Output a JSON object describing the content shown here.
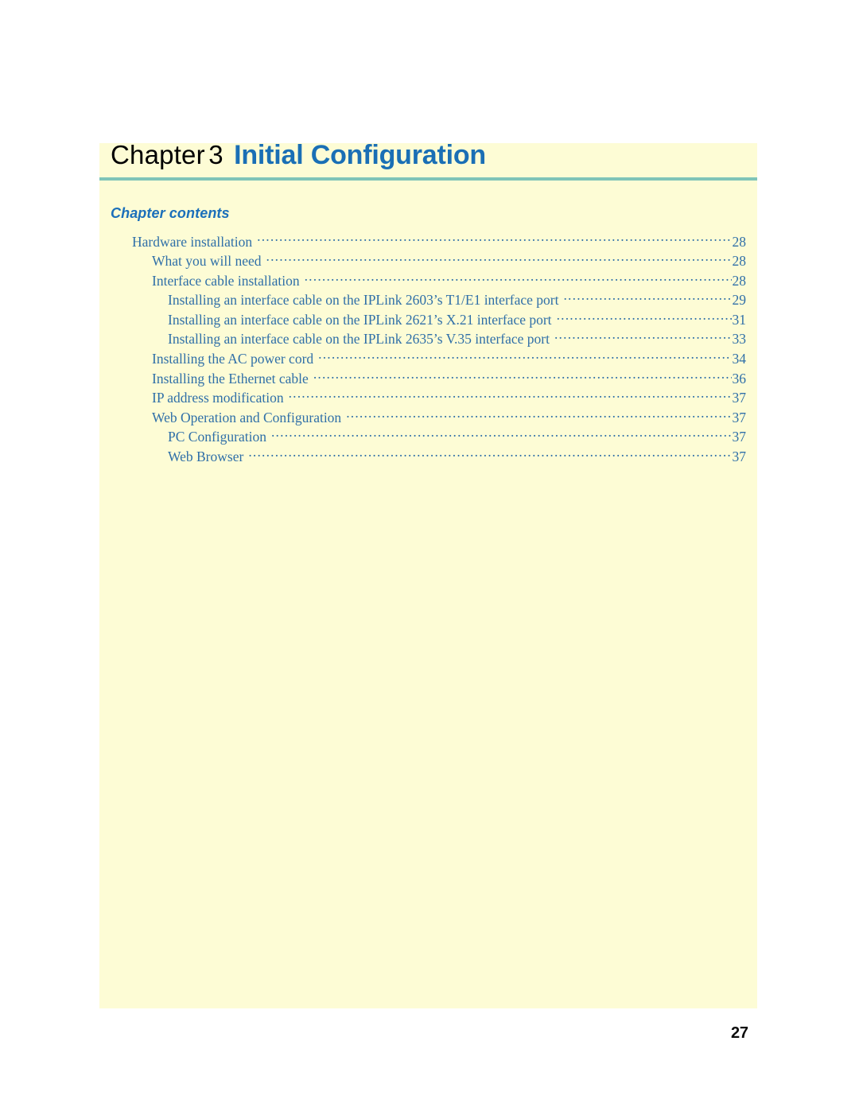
{
  "colors": {
    "panel_background": "#fdfcd5",
    "title_blue": "#1a6fb5",
    "heading_blue": "#1b6fba",
    "toc_blue": "#2f6fa8",
    "rule_teal": "#7fc4b8",
    "folio_black": "#0d0d0d"
  },
  "header": {
    "chapter_word": "Chapter",
    "chapter_number": "3",
    "chapter_name": "Initial Configuration"
  },
  "contents": {
    "heading": "Chapter contents",
    "entries": [
      {
        "label": "Hardware installation",
        "page": "28",
        "level": 1
      },
      {
        "label": "What you will need",
        "page": "28",
        "level": 2
      },
      {
        "label": "Interface cable installation",
        "page": "28",
        "level": 2
      },
      {
        "label": "Installing an interface cable on the IPLink 2603’s T1/E1 interface port",
        "page": "29",
        "level": 3
      },
      {
        "label": "Installing an interface cable on the IPLink 2621’s X.21 interface port",
        "page": "31",
        "level": 3
      },
      {
        "label": "Installing an interface cable on the IPLink 2635’s V.35 interface port",
        "page": "33",
        "level": 3
      },
      {
        "label": "Installing the AC power cord",
        "page": "34",
        "level": 2
      },
      {
        "label": "Installing the Ethernet cable",
        "page": "36",
        "level": 2
      },
      {
        "label": "IP address modification",
        "page": "37",
        "level": 2
      },
      {
        "label": "Web Operation and Configuration",
        "page": "37",
        "level": 2
      },
      {
        "label": "PC Configuration",
        "page": "37",
        "level": 3
      },
      {
        "label": "Web Browser",
        "page": "37",
        "level": 3
      }
    ]
  },
  "footer": {
    "page_number": "27"
  }
}
